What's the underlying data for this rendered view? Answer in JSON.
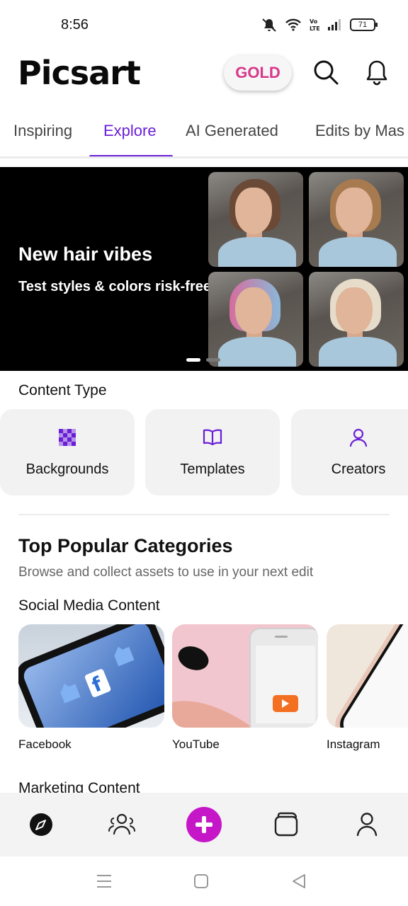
{
  "status_bar": {
    "time": "8:56",
    "battery": "71"
  },
  "header": {
    "logo": "Picsart",
    "gold_label": "GOLD"
  },
  "tabs": [
    {
      "label": "Inspiring"
    },
    {
      "label": "Explore"
    },
    {
      "label": "AI Generated"
    },
    {
      "label": "Edits by Mas"
    }
  ],
  "banner": {
    "title": "New hair vibes",
    "subtitle": "Test styles & colors risk-free."
  },
  "content_type": {
    "title": "Content Type",
    "items": [
      {
        "label": "Backgrounds",
        "icon": "checkerboard-icon"
      },
      {
        "label": "Templates",
        "icon": "book-icon"
      },
      {
        "label": "Creators",
        "icon": "person-icon"
      }
    ]
  },
  "popular": {
    "title": "Top Popular Categories",
    "subtitle": "Browse and collect assets to use in your next edit",
    "social_title": "Social Media Content",
    "items": [
      {
        "label": "Facebook"
      },
      {
        "label": "YouTube"
      },
      {
        "label": "Instagram"
      }
    ],
    "next_section": "Marketing Content"
  },
  "colors": {
    "accent": "#6a1fd6",
    "gold": "#d8378a",
    "create": "#c516c8"
  },
  "bottom_nav": [
    "explore-icon",
    "community-icon",
    "create-icon",
    "projects-icon",
    "profile-icon"
  ]
}
